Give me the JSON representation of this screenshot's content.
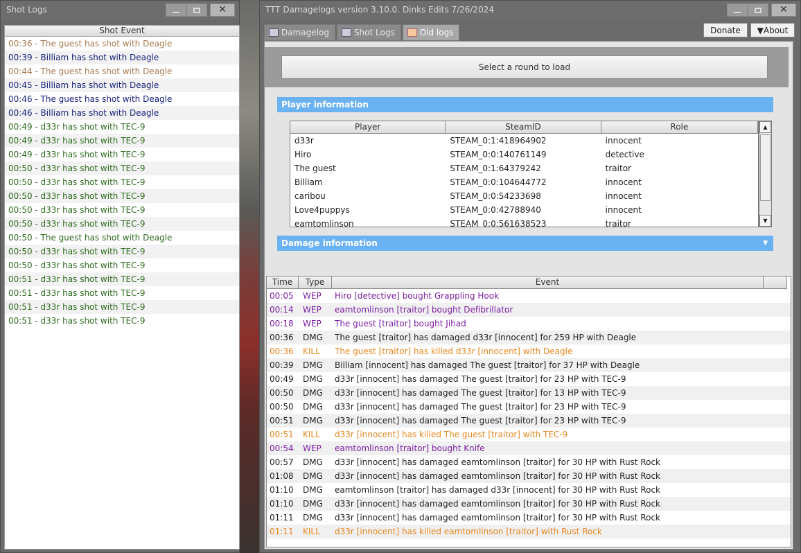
{
  "shot_window": {
    "title": "Shot Logs",
    "column_header": "Shot Event",
    "rows": [
      {
        "text": "00:36 - The guest has shot with Deagle",
        "color": "#a67c52"
      },
      {
        "text": "00:39 - Billiam has shot with Deagle",
        "color": "#1a237e"
      },
      {
        "text": "00:44 - The guest has shot with Deagle",
        "color": "#a67c52"
      },
      {
        "text": "00:45 - Billiam has shot with Deagle",
        "color": "#1a237e"
      },
      {
        "text": "00:46 - The guest has shot with Deagle",
        "color": "#1a237e"
      },
      {
        "text": "00:46 - Billiam has shot with Deagle",
        "color": "#1a237e"
      },
      {
        "text": "00:49 - d33r has shot with TEC-9",
        "color": "#2e6b1e"
      },
      {
        "text": "00:49 - d33r has shot with TEC-9",
        "color": "#2e6b1e"
      },
      {
        "text": "00:49 - d33r has shot with TEC-9",
        "color": "#2e6b1e"
      },
      {
        "text": "00:50 - d33r has shot with TEC-9",
        "color": "#2e6b1e"
      },
      {
        "text": "00:50 - d33r has shot with TEC-9",
        "color": "#2e6b1e"
      },
      {
        "text": "00:50 - d33r has shot with TEC-9",
        "color": "#2e6b1e"
      },
      {
        "text": "00:50 - d33r has shot with TEC-9",
        "color": "#2e6b1e"
      },
      {
        "text": "00:50 - d33r has shot with TEC-9",
        "color": "#2e6b1e"
      },
      {
        "text": "00:50 - The guest has shot with Deagle",
        "color": "#2e6b1e"
      },
      {
        "text": "00:50 - d33r has shot with TEC-9",
        "color": "#2e6b1e"
      },
      {
        "text": "00:50 - d33r has shot with TEC-9",
        "color": "#2e6b1e"
      },
      {
        "text": "00:51 - d33r has shot with TEC-9",
        "color": "#2e6b1e"
      },
      {
        "text": "00:51 - d33r has shot with TEC-9",
        "color": "#2e6b1e"
      },
      {
        "text": "00:51 - d33r has shot with TEC-9",
        "color": "#2e6b1e"
      },
      {
        "text": "00:51 - d33r has shot with TEC-9",
        "color": "#2e6b1e"
      }
    ]
  },
  "dmg_window": {
    "title": "TTT Damagelogs version 3.10.0. Dinks Edits 7/26/2024",
    "tabs": [
      {
        "label": "Damagelog",
        "icon": "table-icon"
      },
      {
        "label": "Shot Logs",
        "icon": "gun-icon"
      },
      {
        "label": "Old logs",
        "icon": "calendar-icon"
      }
    ],
    "donate_label": "Donate",
    "about_label": "▼About",
    "load_button": "Select a round to load",
    "player_info_label": "Player information",
    "damage_info_label": "Damage information",
    "player_columns": [
      "Player",
      "SteamID",
      "Role"
    ],
    "players": [
      {
        "name": "d33r",
        "steamid": "STEAM_0:1:418964902",
        "role": "innocent"
      },
      {
        "name": "Hiro",
        "steamid": "STEAM_0:0:140761149",
        "role": "detective"
      },
      {
        "name": "The guest",
        "steamid": "STEAM_0:1:64379242",
        "role": "traitor"
      },
      {
        "name": "Billiam",
        "steamid": "STEAM_0:0:104644772",
        "role": "innocent"
      },
      {
        "name": "caribou",
        "steamid": "STEAM_0:0:54233698",
        "role": "innocent"
      },
      {
        "name": "Love4puppys",
        "steamid": "STEAM_0:0:42788940",
        "role": "innocent"
      },
      {
        "name": "eamtomlinson",
        "steamid": "STEAM_0:0:561638523",
        "role": "traitor"
      }
    ],
    "event_columns": [
      "Time",
      "Type",
      "Event"
    ],
    "colors": {
      "WEP": "#7b1fa2",
      "DMG": "#222222",
      "KILL": "#e8871e"
    },
    "events": [
      {
        "time": "00:05",
        "type": "WEP",
        "event": "Hiro [detective] bought Grappling Hook"
      },
      {
        "time": "00:14",
        "type": "WEP",
        "event": "eamtomlinson [traitor] bought Defibrillator"
      },
      {
        "time": "00:18",
        "type": "WEP",
        "event": "The guest [traitor] bought Jihad"
      },
      {
        "time": "00:36",
        "type": "DMG",
        "event": "The guest [traitor] has damaged d33r [innocent] for 259 HP with Deagle"
      },
      {
        "time": "00:36",
        "type": "KILL",
        "event": "The guest [traitor] has killed d33r [innocent] with Deagle"
      },
      {
        "time": "00:39",
        "type": "DMG",
        "event": "Billiam [innocent] has damaged The guest [traitor] for 37 HP with Deagle"
      },
      {
        "time": "00:49",
        "type": "DMG",
        "event": "d33r [innocent] has damaged The guest [traitor] for 23 HP with TEC-9"
      },
      {
        "time": "00:50",
        "type": "DMG",
        "event": "d33r [innocent] has damaged The guest [traitor] for 13 HP with TEC-9"
      },
      {
        "time": "00:50",
        "type": "DMG",
        "event": "d33r [innocent] has damaged The guest [traitor] for 23 HP with TEC-9"
      },
      {
        "time": "00:51",
        "type": "DMG",
        "event": "d33r [innocent] has damaged The guest [traitor] for 23 HP with TEC-9"
      },
      {
        "time": "00:51",
        "type": "KILL",
        "event": "d33r [innocent] has killed The guest [traitor] with TEC-9"
      },
      {
        "time": "00:54",
        "type": "WEP",
        "event": "eamtomlinson [traitor] bought Knife"
      },
      {
        "time": "00:57",
        "type": "DMG",
        "event": "d33r [innocent] has damaged eamtomlinson [traitor] for 30 HP with Rust Rock"
      },
      {
        "time": "01:08",
        "type": "DMG",
        "event": "d33r [innocent] has damaged eamtomlinson [traitor] for 30 HP with Rust Rock"
      },
      {
        "time": "01:10",
        "type": "DMG",
        "event": "eamtomlinson [traitor] has damaged d33r [innocent] for 30 HP with Rust Rock"
      },
      {
        "time": "01:10",
        "type": "DMG",
        "event": "d33r [innocent] has damaged eamtomlinson [traitor] for 30 HP with Rust Rock"
      },
      {
        "time": "01:11",
        "type": "DMG",
        "event": "d33r [innocent] has damaged eamtomlinson [traitor] for 30 HP with Rust Rock"
      },
      {
        "time": "01:11",
        "type": "KILL",
        "event": "d33r [innocent] has killed eamtomlinson [traitor] with Rust Rock"
      }
    ]
  }
}
